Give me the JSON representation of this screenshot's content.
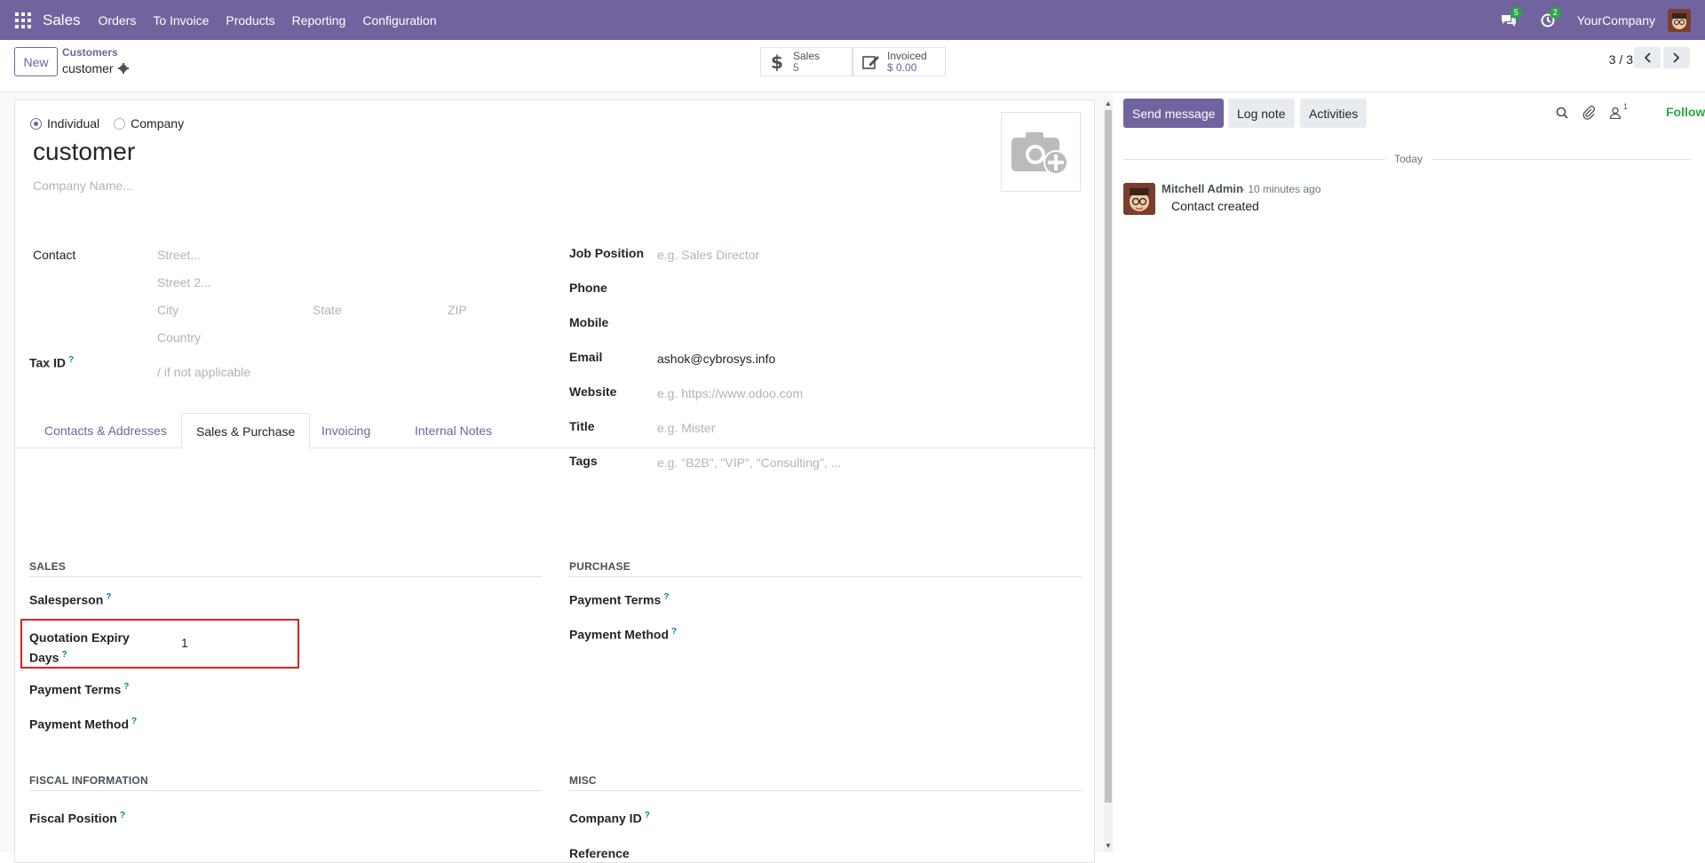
{
  "navbar": {
    "app_name": "Sales",
    "menu": [
      "Orders",
      "To Invoice",
      "Products",
      "Reporting",
      "Configuration"
    ],
    "messages_badge": "5",
    "activities_badge": "2",
    "company": "YourCompany",
    "color": "#71639e"
  },
  "control_panel": {
    "new_label": "New",
    "breadcrumb_parent": "Customers",
    "breadcrumb_current": "customer",
    "smart_buttons": [
      {
        "label": "Sales",
        "value": "5",
        "icon": "dollar-icon"
      },
      {
        "label": "Invoiced",
        "value": "$ 0.00",
        "icon": "edit-icon"
      }
    ],
    "pager": "3 / 3"
  },
  "form": {
    "type_individual": "Individual",
    "type_company": "Company",
    "selected_type": "Individual",
    "name": "customer",
    "company_name_placeholder": "Company Name...",
    "contact_label": "Contact",
    "street_placeholder": "Street...",
    "street2_placeholder": "Street 2...",
    "city_placeholder": "City",
    "state_placeholder": "State",
    "zip_placeholder": "ZIP",
    "country_placeholder": "Country",
    "tax_id_label": "Tax ID",
    "tax_id_placeholder": "/ if not applicable",
    "job_position_label": "Job Position",
    "job_position_placeholder": "e.g. Sales Director",
    "phone_label": "Phone",
    "mobile_label": "Mobile",
    "email_label": "Email",
    "email_value": "ashok@cybrosys.info",
    "website_label": "Website",
    "website_placeholder": "e.g. https://www.odoo.com",
    "title_label": "Title",
    "title_placeholder": "e.g. Mister",
    "tags_label": "Tags",
    "tags_placeholder": "e.g. \"B2B\", \"VIP\", \"Consulting\", ...",
    "tabs": [
      "Contacts & Addresses",
      "Sales & Purchase",
      "Invoicing",
      "Internal Notes"
    ],
    "active_tab": "Sales & Purchase",
    "sales_section": "SALES",
    "salesperson_label": "Salesperson",
    "quotation_expiry_label": "Quotation Expiry Days",
    "quotation_expiry_value": "1",
    "payment_terms_label": "Payment Terms",
    "payment_method_label": "Payment Method",
    "purchase_section": "PURCHASE",
    "purchase_payment_terms_label": "Payment Terms",
    "purchase_payment_method_label": "Payment Method",
    "fiscal_section": "FISCAL INFORMATION",
    "fiscal_position_label": "Fiscal Position",
    "misc_section": "MISC",
    "company_id_label": "Company ID",
    "reference_label": "Reference",
    "help_mark": "?"
  },
  "chatter": {
    "send_message": "Send message",
    "log_note": "Log note",
    "activities": "Activities",
    "followers_count": "1",
    "following": "Following",
    "today": "Today",
    "author": "Mitchell Admin",
    "time": "- 10 minutes ago",
    "body": "Contact created"
  }
}
